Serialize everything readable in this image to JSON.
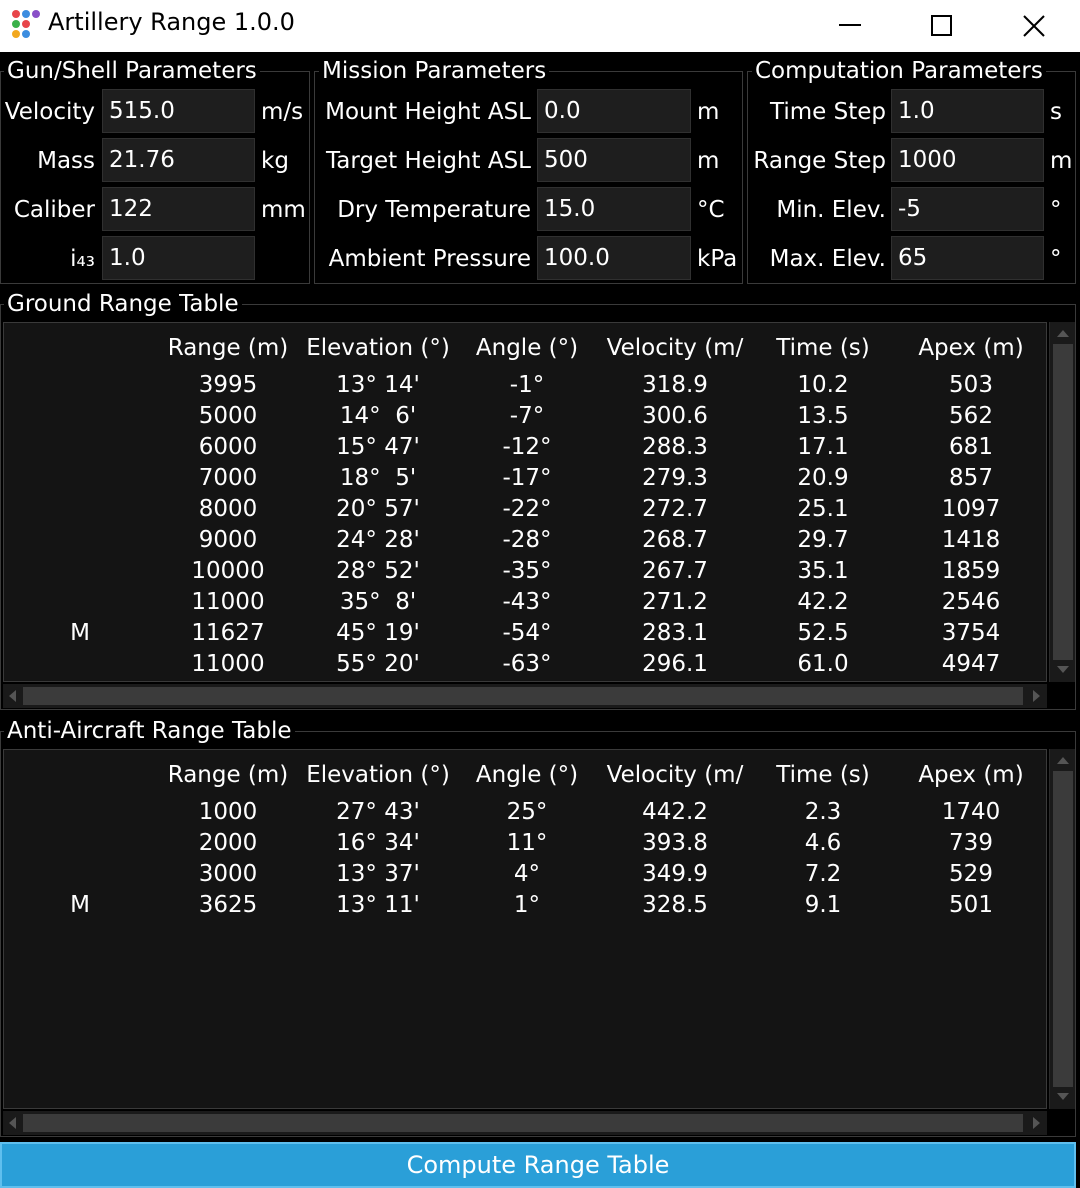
{
  "window": {
    "title": "Artillery Range 1.0.0"
  },
  "groups": {
    "gun": {
      "title": "Gun/Shell Parameters",
      "fields": [
        {
          "label": "Velocity",
          "value": "515.0",
          "unit": "m/s"
        },
        {
          "label": "Mass",
          "value": "21.76",
          "unit": "kg"
        },
        {
          "label": "Caliber",
          "value": "122",
          "unit": "mm"
        },
        {
          "label": "i₄₃",
          "value": "1.0",
          "unit": ""
        }
      ]
    },
    "mission": {
      "title": "Mission Parameters",
      "fields": [
        {
          "label": "Mount Height ASL",
          "value": "0.0",
          "unit": "m"
        },
        {
          "label": "Target Height ASL",
          "value": "500",
          "unit": "m"
        },
        {
          "label": "Dry Temperature",
          "value": "15.0",
          "unit": "°C"
        },
        {
          "label": "Ambient Pressure",
          "value": "100.0",
          "unit": "kPa"
        }
      ]
    },
    "computation": {
      "title": "Computation Parameters",
      "fields": [
        {
          "label": "Time Step",
          "value": "1.0",
          "unit": "s"
        },
        {
          "label": "Range Step",
          "value": "1000",
          "unit": "m"
        },
        {
          "label": "Min. Elev.",
          "value": "-5",
          "unit": "°"
        },
        {
          "label": "Max. Elev.",
          "value": "65",
          "unit": "°"
        }
      ]
    }
  },
  "columns": [
    "Range (m)",
    "Elevation (°)",
    "Angle (°)",
    "Velocity (m/",
    "Time (s)",
    "Apex (m)"
  ],
  "ground": {
    "title": "Ground Range Table",
    "rows": [
      [
        "",
        "3995",
        "13° 14'",
        "-1°",
        "318.9",
        "10.2",
        "503"
      ],
      [
        "",
        "5000",
        "14°  6'",
        "-7°",
        "300.6",
        "13.5",
        "562"
      ],
      [
        "",
        "6000",
        "15° 47'",
        "-12°",
        "288.3",
        "17.1",
        "681"
      ],
      [
        "",
        "7000",
        "18°  5'",
        "-17°",
        "279.3",
        "20.9",
        "857"
      ],
      [
        "",
        "8000",
        "20° 57'",
        "-22°",
        "272.7",
        "25.1",
        "1097"
      ],
      [
        "",
        "9000",
        "24° 28'",
        "-28°",
        "268.7",
        "29.7",
        "1418"
      ],
      [
        "",
        "10000",
        "28° 52'",
        "-35°",
        "267.7",
        "35.1",
        "1859"
      ],
      [
        "",
        "11000",
        "35°  8'",
        "-43°",
        "271.2",
        "42.2",
        "2546"
      ],
      [
        "M",
        "11627",
        "45° 19'",
        "-54°",
        "283.1",
        "52.5",
        "3754"
      ],
      [
        "",
        "11000",
        "55° 20'",
        "-63°",
        "296.1",
        "61.0",
        "4947"
      ]
    ]
  },
  "antiaircraft": {
    "title": "Anti-Aircraft Range Table",
    "rows": [
      [
        "",
        "1000",
        "27° 43'",
        "25°",
        "442.2",
        "2.3",
        "1740"
      ],
      [
        "",
        "2000",
        "16° 34'",
        "11°",
        "393.8",
        "4.6",
        "739"
      ],
      [
        "",
        "3000",
        "13° 37'",
        "4°",
        "349.9",
        "7.2",
        "529"
      ],
      [
        "M",
        "3625",
        "13° 11'",
        "1°",
        "328.5",
        "9.1",
        "501"
      ]
    ]
  },
  "compute_button": "Compute Range Table",
  "colors": {
    "accent": "#2a9fd8",
    "background": "#000000",
    "input_bg": "#1e1e1e"
  },
  "icons": [
    "app-icon",
    "minimize-icon",
    "maximize-icon",
    "close-icon"
  ]
}
